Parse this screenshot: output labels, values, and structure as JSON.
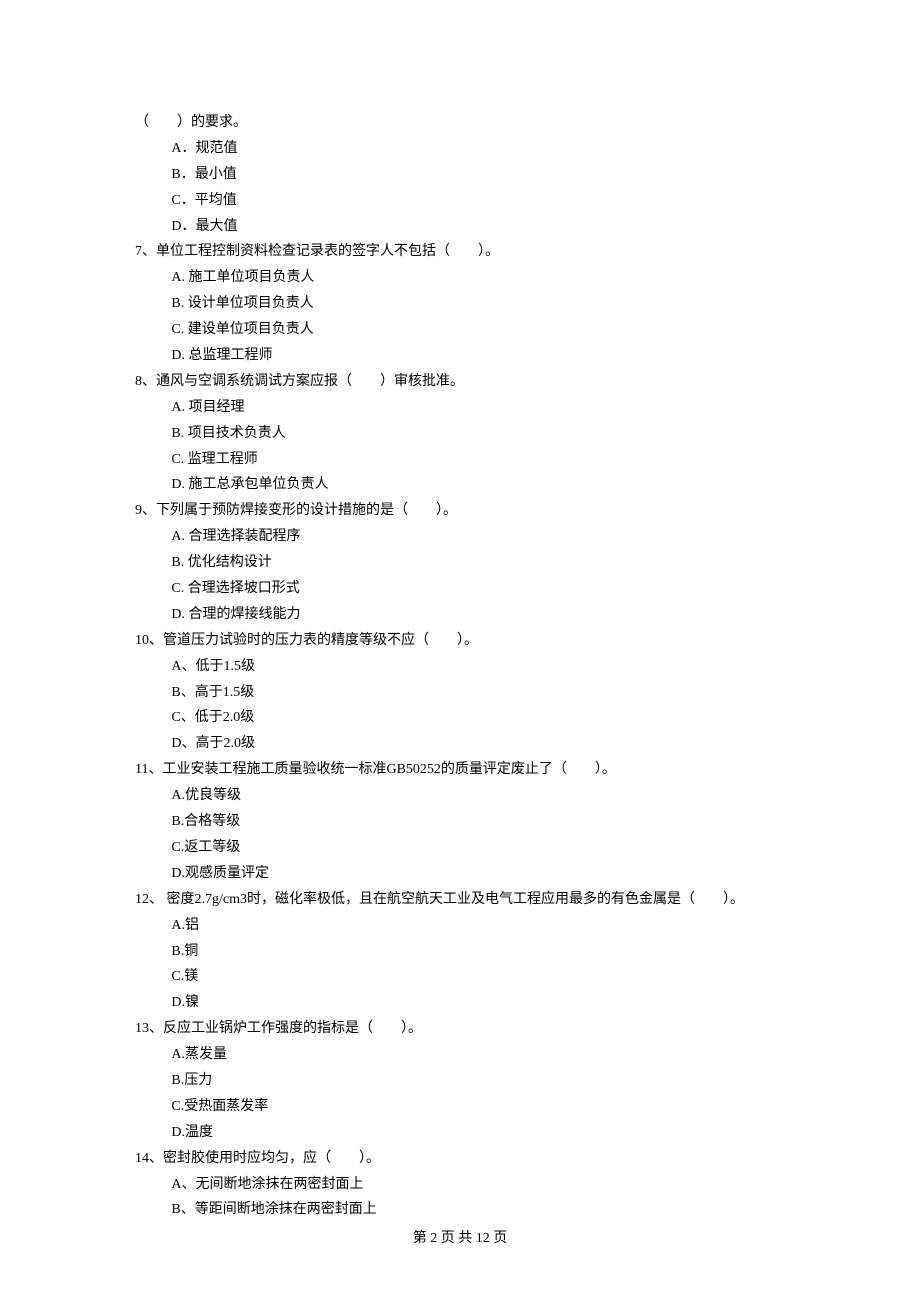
{
  "questions": [
    {
      "stem": "（　　）的要求。",
      "options": [
        "A．规范值",
        "B．最小值",
        "C．平均值",
        "D．最大值"
      ]
    },
    {
      "stem": "7、单位工程控制资料检查记录表的签字人不包括（　　）。",
      "options": [
        "A. 施工单位项目负责人",
        "B. 设计单位项目负责人",
        "C. 建设单位项目负责人",
        "D. 总监理工程师"
      ]
    },
    {
      "stem": "8、通风与空调系统调试方案应报（　　）审核批准。",
      "options": [
        "A. 项目经理",
        "B. 项目技术负责人",
        "C. 监理工程师",
        "D. 施工总承包单位负责人"
      ]
    },
    {
      "stem": "9、下列属于预防焊接变形的设计措施的是（　　）。",
      "options": [
        "A. 合理选择装配程序",
        "B. 优化结构设计",
        "C. 合理选择坡口形式",
        "D. 合理的焊接线能力"
      ]
    },
    {
      "stem": "10、管道压力试验时的压力表的精度等级不应（　　）。",
      "options": [
        "A、低于1.5级",
        "B、高于1.5级",
        "C、低于2.0级",
        "D、高于2.0级"
      ]
    },
    {
      "stem": "11、工业安装工程施工质量验收统一标准GB50252的质量评定废止了（　　）。",
      "options": [
        "A.优良等级",
        "B.合格等级",
        "C.返工等级",
        "D.观感质量评定"
      ]
    },
    {
      "stem": "12、 密度2.7g/cm3时，磁化率极低，且在航空航天工业及电气工程应用最多的有色金属是（　　）。",
      "options": [
        "A.铝",
        "B.铜",
        "C.镁",
        "D.镍"
      ]
    },
    {
      "stem": "13、反应工业锅炉工作强度的指标是（　　）。",
      "options": [
        "A.蒸发量",
        "B.压力",
        "C.受热面蒸发率",
        "D.温度"
      ]
    },
    {
      "stem": "14、密封胶使用时应均匀，应（　　）。",
      "options": [
        "A、无间断地涂抹在两密封面上",
        "B、等距间断地涂抹在两密封面上"
      ]
    }
  ],
  "footer": "第 2 页 共 12 页"
}
